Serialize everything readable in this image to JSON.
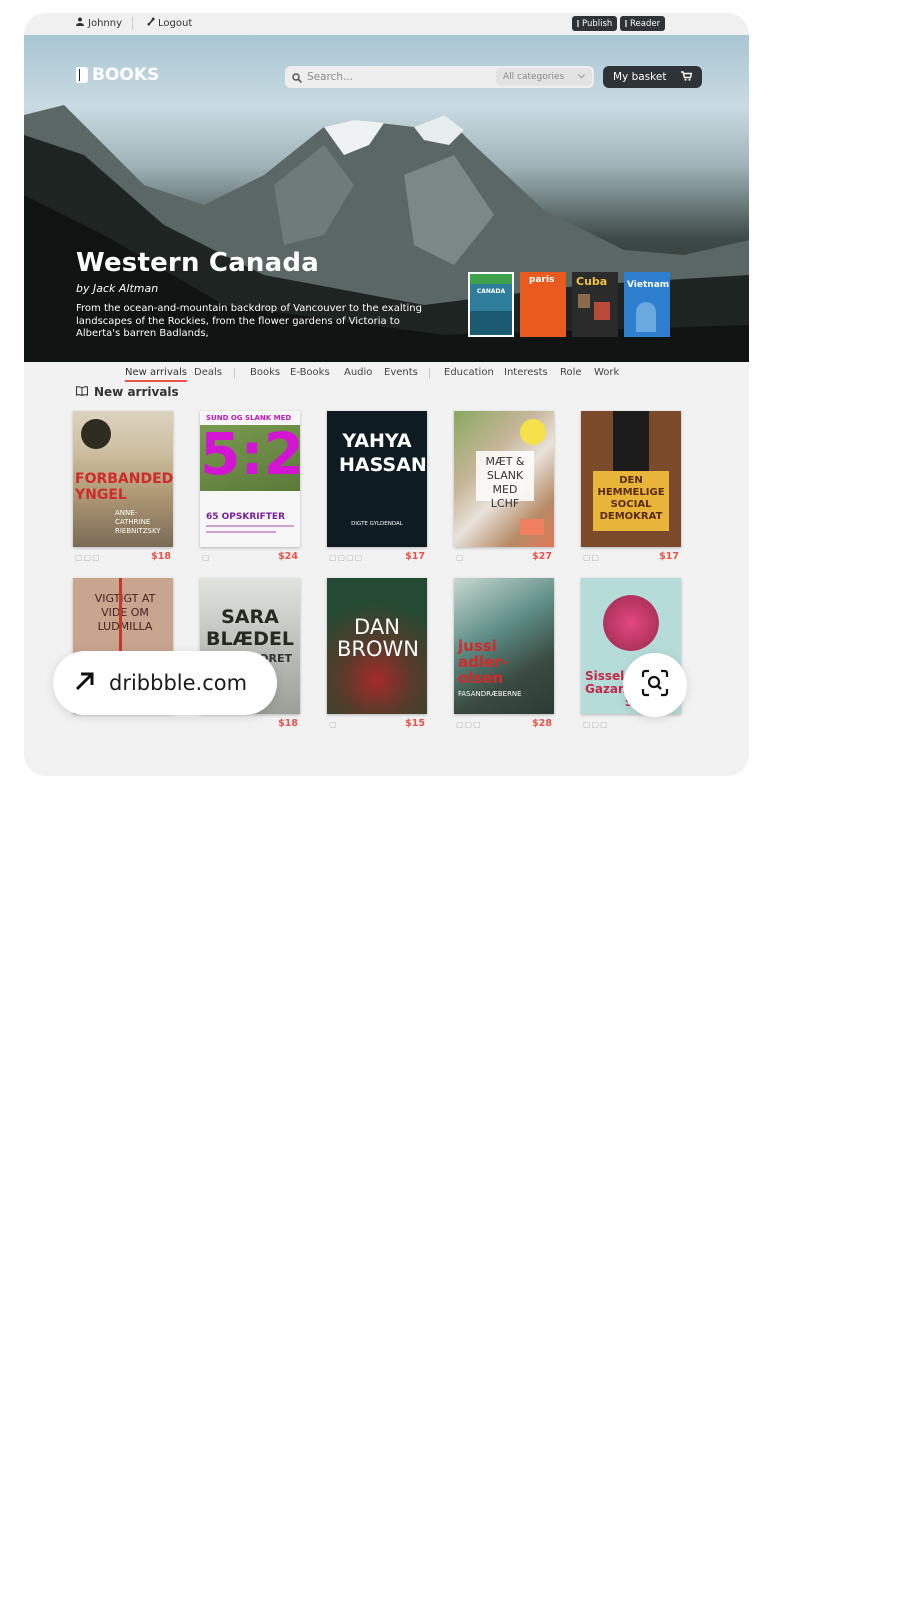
{
  "topbar": {
    "user_name": "Johnny",
    "logout_label": "Logout",
    "publish_label": "Publish",
    "reader_label": "Reader"
  },
  "header": {
    "logo_text": "BOOKS",
    "search_placeholder": "Search...",
    "category_select": "All categories",
    "basket_label": "My basket"
  },
  "hero": {
    "title": "Western Canada",
    "author": "by Jack Altman",
    "description": "From the ocean-and-mountain backdrop of Vancouver to the exalting landscapes of the Rockies, from the flower gardens of Victoria to Alberta's barren Badlands,",
    "featured_books": [
      {
        "title": "CANADA",
        "color": "#2e7d9a"
      },
      {
        "title": "paris",
        "color": "#e85a1e"
      },
      {
        "title": "Cuba",
        "color": "#2b2b2b"
      },
      {
        "title": "Vietnam",
        "color": "#2f7fd1"
      }
    ]
  },
  "nav": {
    "items": [
      "New arrivals",
      "Deals",
      "Books",
      "E-Books",
      "Audio",
      "Events",
      "Education",
      "Interests",
      "Role",
      "Work"
    ],
    "active": "New arrivals"
  },
  "section": {
    "title": "New arrivals"
  },
  "books": [
    {
      "title": "FORBANDEDE YNGEL",
      "author": "ANNE-CATHRINE RIEBNITZSKY",
      "price": "$18"
    },
    {
      "title": "5:2",
      "subtitle": "65 OPSKRIFTER",
      "top": "SUND OG SLANK MED",
      "price": "$24"
    },
    {
      "title": "YAHYA HASSAN",
      "publisher": "DIGTE GYLDENDAL",
      "price": "$17"
    },
    {
      "title": "MÆT & SLANK MED LCHF",
      "price": "$27"
    },
    {
      "title": "DEN HEMMELIGE SOCIAL DEMOKRAT",
      "price": "$17"
    },
    {
      "title": "VIGTIGT AT VIDE OM LUDMILLA",
      "price": ""
    },
    {
      "title": "SARA BLÆDEL",
      "subtitle": "DØDESPORET",
      "price": "$18"
    },
    {
      "title": "DAN BROWN",
      "price": "$15"
    },
    {
      "title": "jussi adler-olsen",
      "subtitle": "FASANDRÆBERNE",
      "price": "$28"
    },
    {
      "title": "Sissel-Jo Gazan",
      "subtitle": "Svar",
      "price": ""
    }
  ],
  "overlay": {
    "source_label": "dribbble.com"
  },
  "colors": {
    "accent": "#e8534a",
    "dark": "#2d3337"
  }
}
